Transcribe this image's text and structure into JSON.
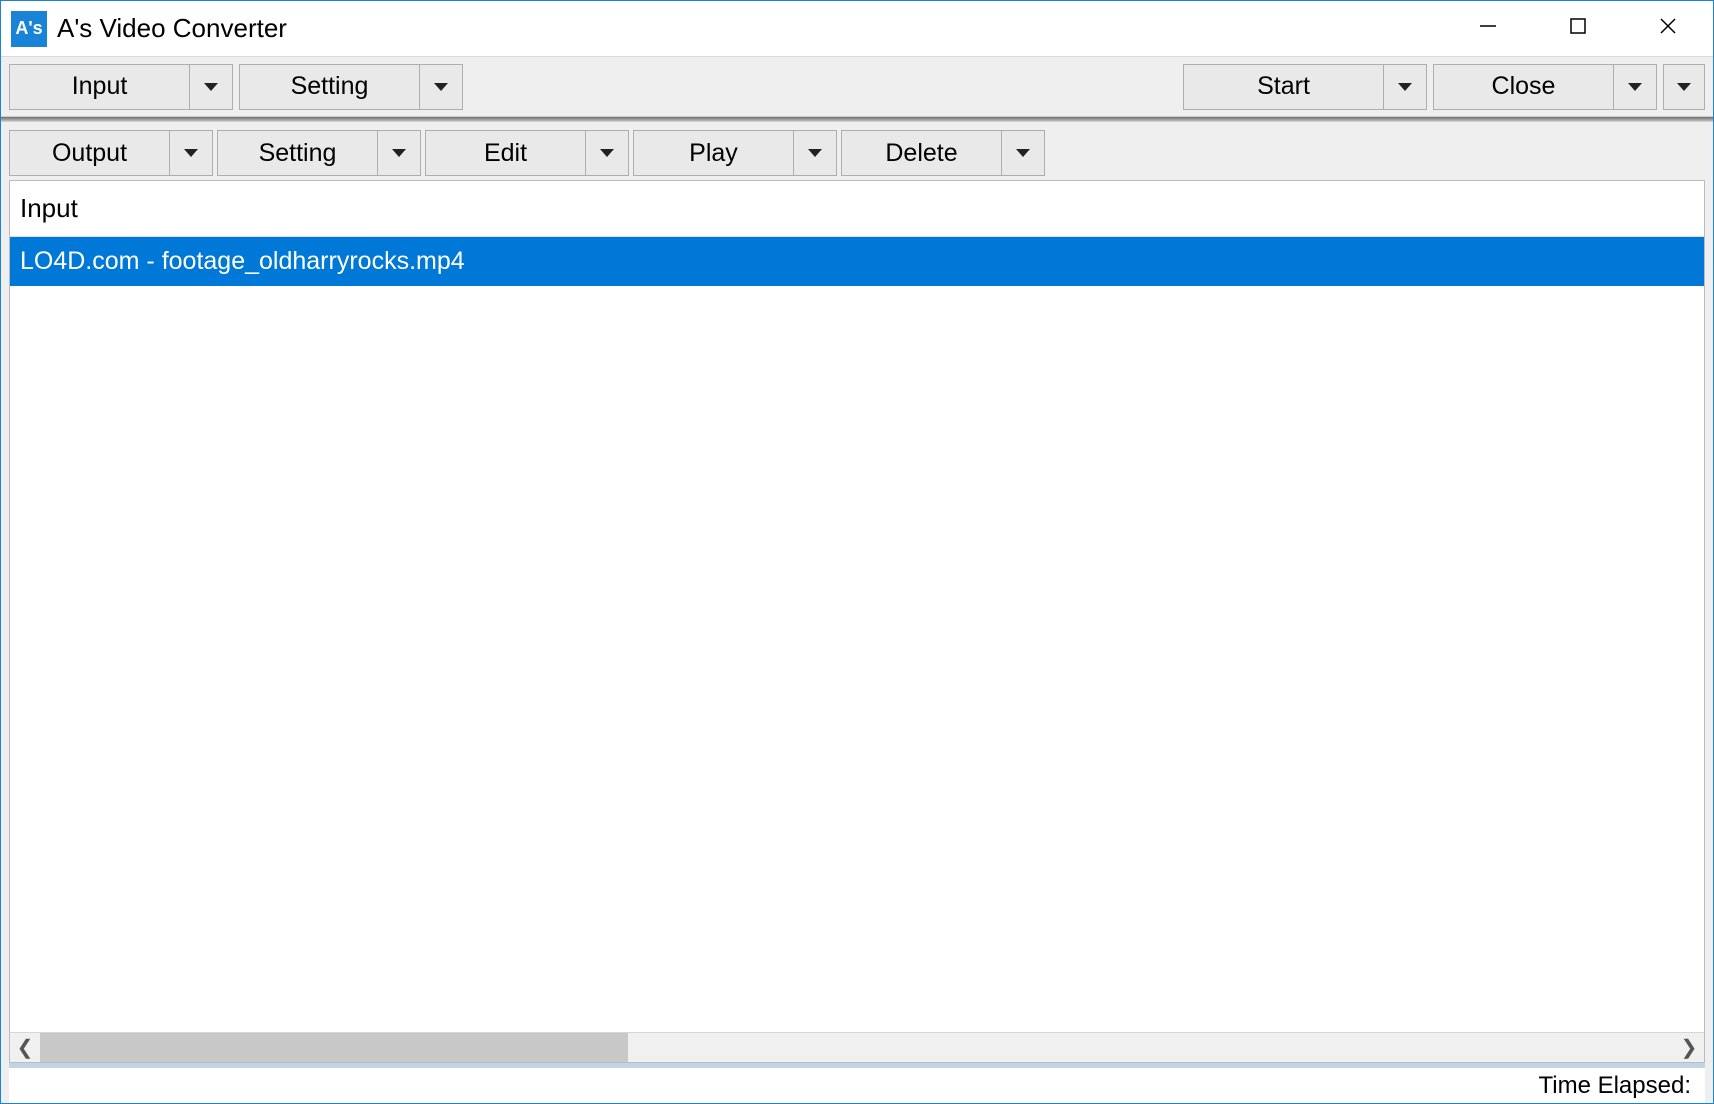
{
  "titlebar": {
    "app_icon_text": "A's",
    "title": "A's Video Converter"
  },
  "top_toolbar": {
    "input_label": "Input",
    "setting_label": "Setting",
    "start_label": "Start",
    "close_label": "Close"
  },
  "sec_toolbar": {
    "output_label": "Output",
    "setting_label": "Setting",
    "edit_label": "Edit",
    "play_label": "Play",
    "delete_label": "Delete"
  },
  "list": {
    "header": "Input",
    "rows": [
      {
        "label": "LO4D.com - footage_oldharryrocks.mp4",
        "selected": true
      }
    ]
  },
  "statusbar": {
    "time_elapsed_label": "Time Elapsed:"
  },
  "colors": {
    "accent": "#0078d7",
    "window_border": "#1883d7"
  }
}
